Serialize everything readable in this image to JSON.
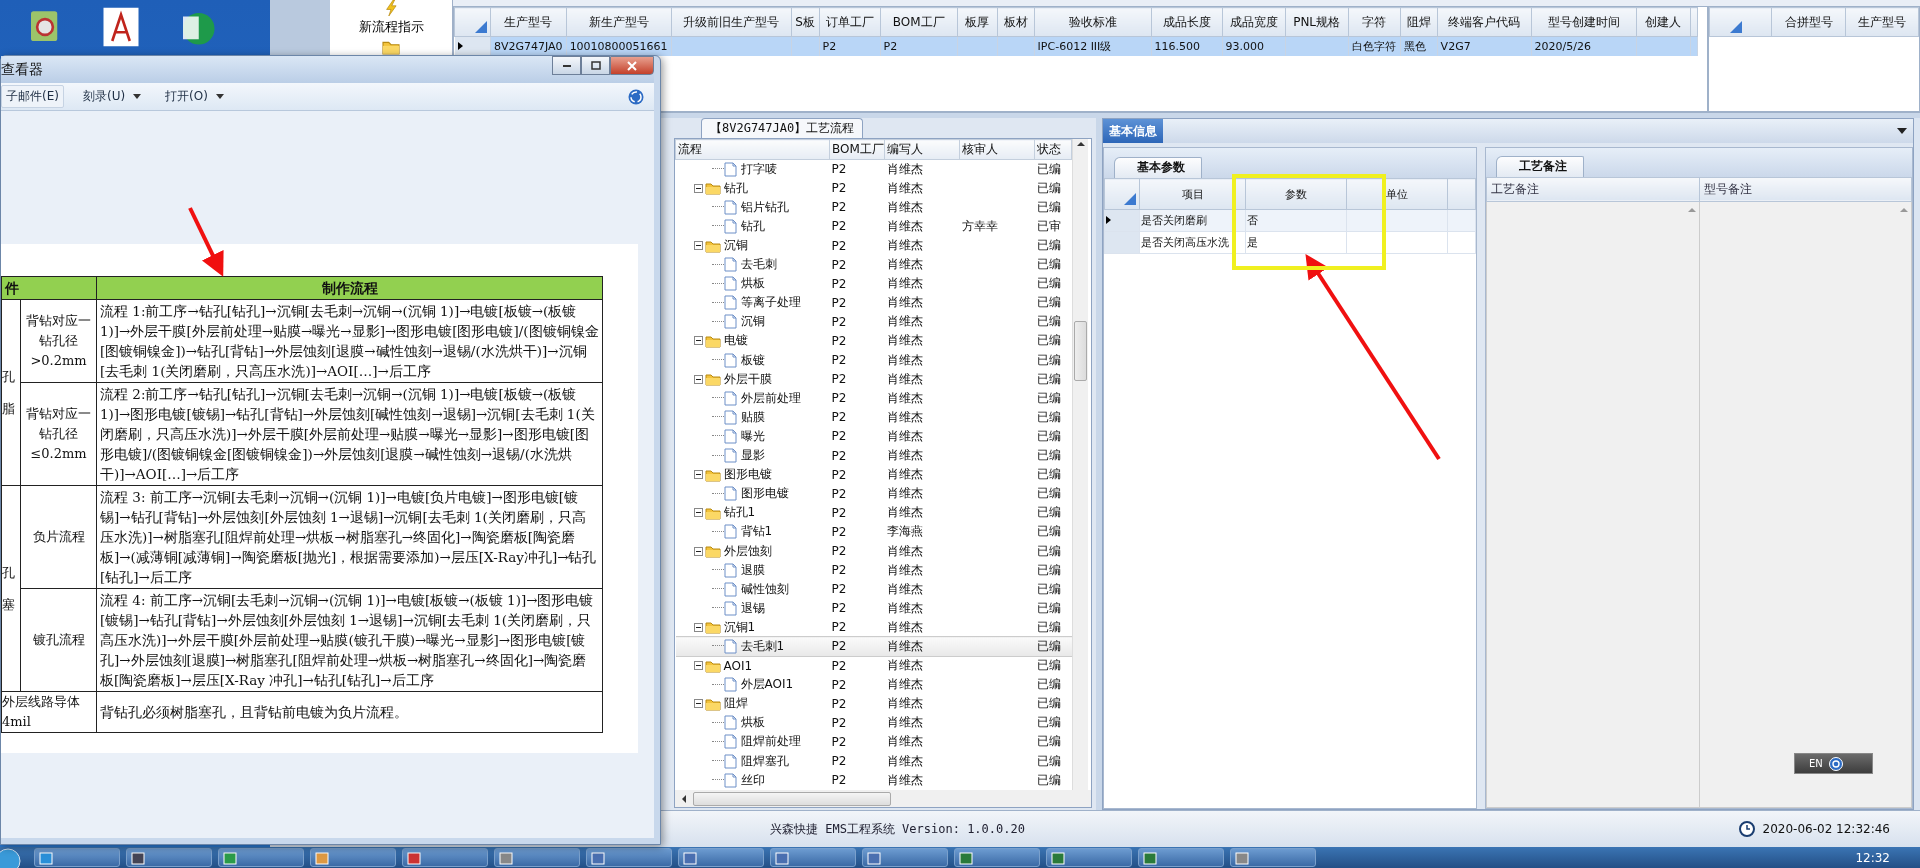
{
  "toolbar": {
    "button": "新流程指示"
  },
  "model_grid": {
    "columns": [
      "生产型号",
      "新生产型号",
      "升级前旧生产型号",
      "S板",
      "订单工厂",
      "BOM工厂",
      "板厚",
      "板材",
      "验收标准",
      "成品长度",
      "成品宽度",
      "PNL规格",
      "字符",
      "阻焊",
      "终端客户代码",
      "型号创建时间",
      "创建人"
    ],
    "rows": [
      {
        "selected": true,
        "cells": [
          "8V2G747JA0",
          "10010800051661",
          null,
          null,
          "P2",
          "P2",
          null,
          null,
          "IPC-6012 III级",
          "116.500",
          "93.000",
          null,
          "白色字符",
          "黑色",
          "V2G7",
          "2020/5/26",
          null
        ]
      }
    ]
  },
  "merge_grid": {
    "columns": [
      "合拼型号",
      "生产型号"
    ]
  },
  "flow_panel": {
    "tab": "【8V2G747JA0】工艺流程",
    "columns": [
      "流程",
      "BOM工厂",
      "编写人",
      "核审人",
      "状态"
    ],
    "nodes": [
      {
        "kind": "folder",
        "children": [
          {
            "kind": "doc",
            "label": "打字唛",
            "bom": "P2",
            "author": "肖维杰",
            "status": "已编",
            "selected": false
          }
        ]
      },
      {
        "kind": "folder",
        "label": "钻孔",
        "bom": "P2",
        "author": "肖维杰",
        "status": "已编",
        "expanded": true,
        "selected": false,
        "children": [
          {
            "kind": "doc",
            "label": "铝片钻孔",
            "bom": "P2",
            "author": "肖维杰",
            "status": "已编",
            "selected": false
          },
          {
            "kind": "doc",
            "label": "钻孔",
            "bom": "P2",
            "author": "肖维杰",
            "reviewer": "方幸幸",
            "status": "已审",
            "selected": false
          }
        ]
      },
      {
        "kind": "folder",
        "label": "沉铜",
        "bom": "P2",
        "author": "肖维杰",
        "status": "已编",
        "expanded": true,
        "selected": false,
        "children": [
          {
            "kind": "doc",
            "label": "去毛刺",
            "bom": "P2",
            "author": "肖维杰",
            "status": "已编",
            "selected": false
          },
          {
            "kind": "doc",
            "label": "烘板",
            "bom": "P2",
            "author": "肖维杰",
            "status": "已编",
            "selected": false
          },
          {
            "kind": "doc",
            "label": "等离子处理",
            "bom": "P2",
            "author": "肖维杰",
            "status": "已编",
            "selected": false
          },
          {
            "kind": "doc",
            "label": "沉铜",
            "bom": "P2",
            "author": "肖维杰",
            "status": "已编",
            "selected": false
          }
        ]
      },
      {
        "kind": "folder",
        "label": "电镀",
        "bom": "P2",
        "author": "肖维杰",
        "status": "已编",
        "expanded": true,
        "selected": false,
        "children": [
          {
            "kind": "doc",
            "label": "板镀",
            "bom": "P2",
            "author": "肖维杰",
            "status": "已编",
            "selected": false
          }
        ]
      },
      {
        "kind": "folder",
        "label": "外层干膜",
        "bom": "P2",
        "author": "肖维杰",
        "status": "已编",
        "expanded": true,
        "selected": false,
        "children": [
          {
            "kind": "doc",
            "label": "外层前处理",
            "bom": "P2",
            "author": "肖维杰",
            "status": "已编",
            "selected": false
          },
          {
            "kind": "doc",
            "label": "贴膜",
            "bom": "P2",
            "author": "肖维杰",
            "status": "已编",
            "selected": false
          },
          {
            "kind": "doc",
            "label": "曝光",
            "bom": "P2",
            "author": "肖维杰",
            "status": "已编",
            "selected": false
          },
          {
            "kind": "doc",
            "label": "显影",
            "bom": "P2",
            "author": "肖维杰",
            "status": "已编",
            "selected": false
          }
        ]
      },
      {
        "kind": "folder",
        "label": "图形电镀",
        "bom": "P2",
        "author": "肖维杰",
        "status": "已编",
        "expanded": true,
        "selected": false,
        "children": [
          {
            "kind": "doc",
            "label": "图形电镀",
            "bom": "P2",
            "author": "肖维杰",
            "status": "已编",
            "selected": false
          }
        ]
      },
      {
        "kind": "folder",
        "label": "钻孔1",
        "bom": "P2",
        "author": "肖维杰",
        "status": "已编",
        "expanded": true,
        "selected": false,
        "children": [
          {
            "kind": "doc",
            "label": "背钻1",
            "bom": "P2",
            "author": "李海燕",
            "status": "已编",
            "selected": false
          }
        ]
      },
      {
        "kind": "folder",
        "label": "外层蚀刻",
        "bom": "P2",
        "author": "肖维杰",
        "status": "已编",
        "expanded": true,
        "selected": false,
        "children": [
          {
            "kind": "doc",
            "label": "退膜",
            "bom": "P2",
            "author": "肖维杰",
            "status": "已编",
            "selected": false
          },
          {
            "kind": "doc",
            "label": "碱性蚀刻",
            "bom": "P2",
            "author": "肖维杰",
            "status": "已编",
            "selected": false
          },
          {
            "kind": "doc",
            "label": "退锡",
            "bom": "P2",
            "author": "肖维杰",
            "status": "已编",
            "selected": false
          }
        ]
      },
      {
        "kind": "folder",
        "label": "沉铜1",
        "bom": "P2",
        "author": "肖维杰",
        "status": "已编",
        "expanded": true,
        "selected": false,
        "children": [
          {
            "kind": "doc",
            "label": "去毛刺1",
            "bom": "P2",
            "author": "肖维杰",
            "status": "已编",
            "selected": true
          }
        ]
      },
      {
        "kind": "folder",
        "label": "AOI1",
        "bom": "P2",
        "author": "肖维杰",
        "status": "已编",
        "expanded": true,
        "selected": false,
        "children": [
          {
            "kind": "doc",
            "label": "外层AOI1",
            "bom": "P2",
            "author": "肖维杰",
            "status": "已编",
            "selected": false
          }
        ]
      },
      {
        "kind": "folder",
        "label": "阻焊",
        "bom": "P2",
        "author": "肖维杰",
        "status": "已编",
        "expanded": true,
        "selected": false,
        "children": [
          {
            "kind": "doc",
            "label": "烘板",
            "bom": "P2",
            "author": "肖维杰",
            "status": "已编",
            "selected": false
          },
          {
            "kind": "doc",
            "label": "阻焊前处理",
            "bom": "P2",
            "author": "肖维杰",
            "status": "已编",
            "selected": false
          },
          {
            "kind": "doc",
            "label": "阻焊塞孔",
            "bom": "P2",
            "author": "肖维杰",
            "status": "已编",
            "selected": false
          },
          {
            "kind": "doc",
            "label": "丝印",
            "bom": "P2",
            "author": "肖维杰",
            "status": "已编",
            "selected": false
          }
        ]
      }
    ]
  },
  "info_panel": {
    "tab": {
      "label": "基本信息",
      "selected": true
    },
    "params": {
      "tab": "基本参数",
      "columns": [
        "项目",
        "参数",
        "单位"
      ],
      "rows": [
        {
          "item": "是否关闭磨刷",
          "value": "否",
          "current": true
        },
        {
          "item": "是否关闭高压水洗",
          "value": "是",
          "current": false
        }
      ]
    },
    "notes": {
      "tab": "工艺备注",
      "columns": [
        "工艺备注",
        "型号备注"
      ]
    }
  },
  "status_bar": {
    "product": "兴森快捷 EMS工程系统 Version: 1.0.0.20",
    "datetime": "2020-06-02 12:32:46"
  },
  "language_bar": {
    "label": "EN"
  },
  "taskbar": {
    "clock": "12:32"
  },
  "viewer": {
    "title": "查看器",
    "menu": [
      {
        "label": "子邮件(E)",
        "dropdown": false
      },
      {
        "label": "刻录(U)",
        "dropdown": true
      },
      {
        "label": "打开(O)",
        "dropdown": true
      }
    ],
    "document": {
      "columns": [
        "件",
        "制作流程"
      ],
      "groups": [
        {
          "kind": "group",
          "side": [
            "孔",
            "脂"
          ],
          "rows": [
            {
              "condition": "背钻对应一钻孔径>0.2mm",
              "flow": "流程 1:前工序→钻孔[钻孔]→沉铜[去毛刺→沉铜→(沉铜 1)]→电镀[板镀→(板镀 1)]→外层干膜[外层前处理→贴膜→曝光→显影]→图形电镀[图形电镀]/(图镀铜镍金[图镀铜镍金])→钻孔[背钻]→外层蚀刻[退膜→碱性蚀刻→退锡/(水洗烘干)]→沉铜[去毛刺 1(关闭磨刷，只高压水洗)]→AOI[…]→后工序"
            },
            {
              "condition": "背钻对应一钻孔径≤0.2mm",
              "flow": "流程 2:前工序→钻孔[钻孔]→沉铜[去毛刺→沉铜→(沉铜 1)]→电镀[板镀→(板镀 1)]→图形电镀[镀锡]→钻孔[背钻]→外层蚀刻[碱性蚀刻→退锡]→沉铜[去毛刺 1(关闭磨刷，只高压水洗)]→外层干膜[外层前处理→贴膜→曝光→显影]→图形电镀[图形电镀]/(图镀铜镍金[图镀铜镍金])→外层蚀刻[退膜→碱性蚀刻→退锡/(水洗烘干)]→AOI[…]→后工序"
            }
          ]
        },
        {
          "kind": "group",
          "side": [
            "孔",
            "塞"
          ],
          "rows": [
            {
              "condition": "负片流程",
              "flow": "流程 3: 前工序→沉铜[去毛刺→沉铜→(沉铜 1)]→电镀[负片电镀]→图形电镀[镀锡]→钻孔[背钻]→外层蚀刻[外层蚀刻 1→退锡]→沉铜[去毛刺 1(关闭磨刷，只高压水洗)]→树脂塞孔[阻焊前处理→烘板→树脂塞孔→终固化]→陶瓷磨板[陶瓷磨板]→(减薄铜[减薄铜]→陶瓷磨板[抛光]，根据需要添加)→层压[X-Ray冲孔]→钻孔[钻孔]→后工序"
            },
            {
              "condition": "镀孔流程",
              "flow": "流程 4: 前工序→沉铜[去毛刺→沉铜→(沉铜 1)]→电镀[板镀→(板镀 1)]→图形电镀[镀锡]→钻孔[背钻]→外层蚀刻[外层蚀刻 1→退锡]→沉铜[去毛刺 1(关闭磨刷，只高压水洗)]→外层干膜[外层前处理→贴膜(镀孔干膜)→曝光→显影]→图形电镀[镀孔]→外层蚀刻[退膜]→树脂塞孔[阻焊前处理→烘板→树脂塞孔→终固化]→陶瓷磨板[陶瓷磨板]→层压[X-Ray 冲孔]→钻孔[钻孔]→后工序"
            }
          ]
        },
        {
          "kind": "note",
          "label": [
            "外层线路导体",
            "4mil"
          ],
          "flow": "背钻孔必须树脂塞孔，且背钻前电镀为负片流程。"
        }
      ]
    }
  }
}
